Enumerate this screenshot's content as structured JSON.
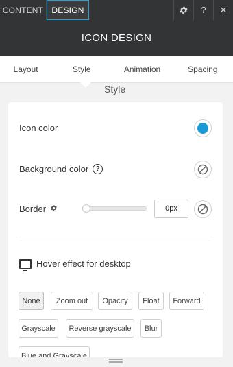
{
  "topbar": {
    "tabs": [
      {
        "label": "CONTENT",
        "active": false
      },
      {
        "label": "DESIGN",
        "active": true
      }
    ],
    "controls": {
      "settings_icon": "gear-icon",
      "help_label": "?",
      "close_label": "✕"
    }
  },
  "header": {
    "title": "ICON DESIGN"
  },
  "subtabs": {
    "items": [
      {
        "label": "Layout"
      },
      {
        "label": "Style"
      },
      {
        "label": "Animation"
      },
      {
        "label": "Spacing"
      }
    ]
  },
  "section": {
    "label": "Style"
  },
  "style": {
    "icon_color": {
      "label": "Icon color",
      "value": "#1a9ad6"
    },
    "background_color": {
      "label": "Background color",
      "help": "?"
    },
    "border": {
      "label": "Border",
      "input_value": "0px",
      "slider_value": 0
    }
  },
  "hover": {
    "label": "Hover effect for desktop",
    "options": [
      "None",
      "Zoom out",
      "Opacity",
      "Float",
      "Forward",
      "Grayscale",
      "Reverse grayscale",
      "Blur",
      "Blue and Grayscale"
    ],
    "selected": "None"
  },
  "colors": {
    "accent": "#1ea0dc",
    "dark": "#323436"
  }
}
